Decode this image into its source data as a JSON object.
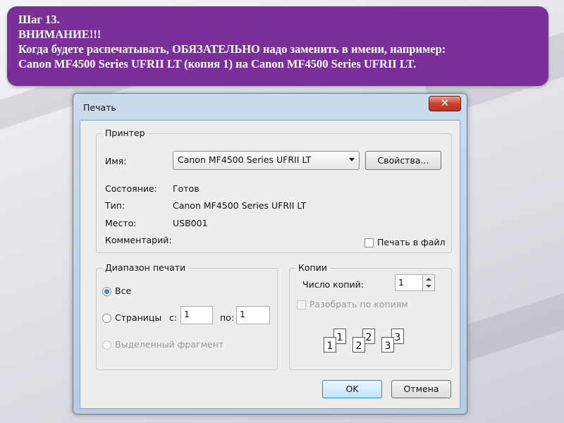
{
  "banner": {
    "line1": "Шаг 13.",
    "line2": "ВНИМАНИЕ!!!",
    "line3": "Когда будете распечатывать, ОБЯЗАТЕЛЬНО надо заменить в имени, например:",
    "line4": "Canon MF4500 Series UFRII LT (копия 1) на Canon MF4500 Series UFRII LT."
  },
  "dialog": {
    "title": "Печать",
    "close_glyph": "✕",
    "printer": {
      "legend": "Принтер",
      "name_label": "Имя:",
      "name_value": "Canon MF4500 Series UFRII LT",
      "properties_button": "Свойства...",
      "status_label": "Состояние:",
      "status_value": "Готов",
      "type_label": "Тип:",
      "type_value": "Canon MF4500 Series UFRII LT",
      "where_label": "Место:",
      "where_value": "USB001",
      "comment_label": "Комментарий:",
      "print_to_file_label": "Печать в файл",
      "print_to_file_checked": false
    },
    "range": {
      "legend": "Диапазон печати",
      "all_label": "Все",
      "pages_label": "Страницы",
      "from_label": "с:",
      "from_value": "1",
      "to_label": "по:",
      "to_value": "1",
      "selection_label": "Выделенный фрагмент",
      "selected": "all"
    },
    "copies": {
      "legend": "Копии",
      "count_label": "Число копий:",
      "count_value": "1",
      "collate_label": "Разобрать по копиям",
      "collate_checked": false,
      "collate_pages": [
        "1",
        "1",
        "2",
        "2",
        "3",
        "3"
      ]
    },
    "ok_button": "OK",
    "cancel_button": "Отмена"
  },
  "colors": {
    "banner_bg": "#7b2f99",
    "dialog_frame": "#b6cce3",
    "close_red": "#c9452e"
  }
}
